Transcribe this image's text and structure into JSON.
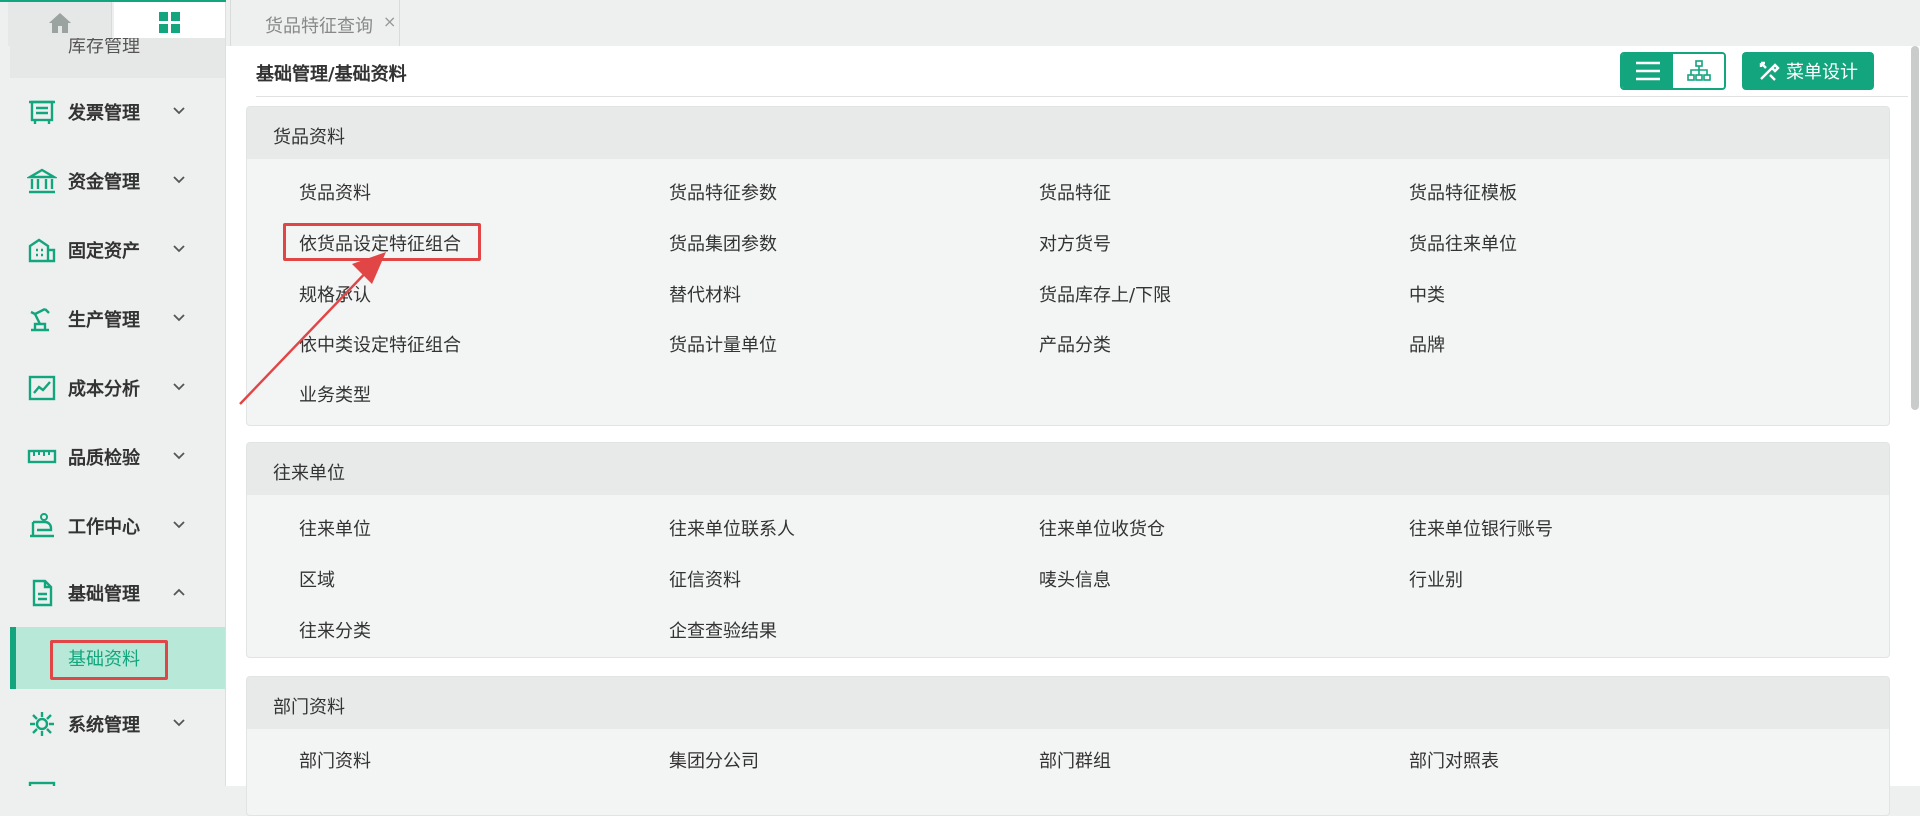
{
  "sidebar": {
    "cut_item_label": "库存管理",
    "items": [
      {
        "label": "发票管理",
        "icon": "invoice-icon",
        "expanded": false
      },
      {
        "label": "资金管理",
        "icon": "bank-icon",
        "expanded": false
      },
      {
        "label": "固定资产",
        "icon": "building-icon",
        "expanded": false
      },
      {
        "label": "生产管理",
        "icon": "robot-arm-icon",
        "expanded": false
      },
      {
        "label": "成本分析",
        "icon": "chart-trend-icon",
        "expanded": false
      },
      {
        "label": "品质检验",
        "icon": "ruler-icon",
        "expanded": false
      },
      {
        "label": "工作中心",
        "icon": "workstation-icon",
        "expanded": false
      },
      {
        "label": "基础管理",
        "icon": "document-icon",
        "expanded": true
      },
      {
        "label": "系统管理",
        "icon": "gear-icon",
        "expanded": false
      },
      {
        "label": "",
        "icon": "partial-icon",
        "expanded": false
      }
    ],
    "active_sub": "基础资料"
  },
  "tabs": {
    "active_label": "货品特征查询",
    "close_glyph": "×"
  },
  "main": {
    "breadcrumb": "基础管理/基础资料",
    "menu_design_label": "菜单设计",
    "sections": [
      {
        "title": "货品资料",
        "links": [
          "货品资料",
          "货品特征参数",
          "货品特征",
          "货品特征模板",
          "依货品设定特征组合",
          "货品集团参数",
          "对方货号",
          "货品往来单位",
          "规格承认",
          "替代材料",
          "货品库存上/下限",
          "中类",
          "依中类设定特征组合",
          "货品计量单位",
          "产品分类",
          "品牌",
          "业务类型"
        ]
      },
      {
        "title": "往来单位",
        "links": [
          "往来单位",
          "往来单位联系人",
          "往来单位收货仓",
          "往来单位银行账号",
          "区域",
          "征信资料",
          "唛头信息",
          "行业别",
          "往来分类",
          "企查查验结果"
        ]
      },
      {
        "title": "部门资料",
        "links": [
          "部门资料",
          "集团分公司",
          "部门群组",
          "部门对照表"
        ]
      }
    ]
  },
  "colors": {
    "accent": "#13a57d",
    "highlight": "#e14545",
    "active_sub_bg": "#b8e8d7"
  }
}
